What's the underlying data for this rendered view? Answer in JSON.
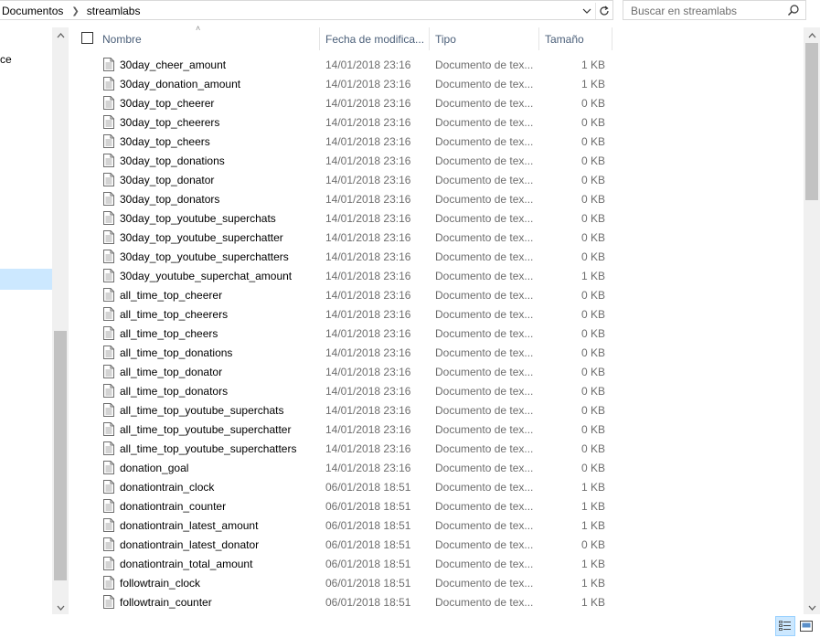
{
  "address": {
    "crumbs": [
      "Documentos",
      "streamlabs"
    ],
    "dropdown_icon": "chevron-down-icon",
    "refresh_icon": "refresh-icon"
  },
  "search": {
    "placeholder": "Buscar en streamlabs",
    "icon": "search-icon"
  },
  "nav": {
    "partial_label": "ce"
  },
  "columns": {
    "name": "Nombre",
    "date": "Fecha de modifica...",
    "type": "Tipo",
    "size": "Tamaño"
  },
  "files": [
    {
      "name": "30day_cheer_amount",
      "date": "14/01/2018 23:16",
      "type": "Documento de tex...",
      "size": "1 KB"
    },
    {
      "name": "30day_donation_amount",
      "date": "14/01/2018 23:16",
      "type": "Documento de tex...",
      "size": "1 KB"
    },
    {
      "name": "30day_top_cheerer",
      "date": "14/01/2018 23:16",
      "type": "Documento de tex...",
      "size": "0 KB"
    },
    {
      "name": "30day_top_cheerers",
      "date": "14/01/2018 23:16",
      "type": "Documento de tex...",
      "size": "0 KB"
    },
    {
      "name": "30day_top_cheers",
      "date": "14/01/2018 23:16",
      "type": "Documento de tex...",
      "size": "0 KB"
    },
    {
      "name": "30day_top_donations",
      "date": "14/01/2018 23:16",
      "type": "Documento de tex...",
      "size": "0 KB"
    },
    {
      "name": "30day_top_donator",
      "date": "14/01/2018 23:16",
      "type": "Documento de tex...",
      "size": "0 KB"
    },
    {
      "name": "30day_top_donators",
      "date": "14/01/2018 23:16",
      "type": "Documento de tex...",
      "size": "0 KB"
    },
    {
      "name": "30day_top_youtube_superchats",
      "date": "14/01/2018 23:16",
      "type": "Documento de tex...",
      "size": "0 KB"
    },
    {
      "name": "30day_top_youtube_superchatter",
      "date": "14/01/2018 23:16",
      "type": "Documento de tex...",
      "size": "0 KB"
    },
    {
      "name": "30day_top_youtube_superchatters",
      "date": "14/01/2018 23:16",
      "type": "Documento de tex...",
      "size": "0 KB"
    },
    {
      "name": "30day_youtube_superchat_amount",
      "date": "14/01/2018 23:16",
      "type": "Documento de tex...",
      "size": "1 KB"
    },
    {
      "name": "all_time_top_cheerer",
      "date": "14/01/2018 23:16",
      "type": "Documento de tex...",
      "size": "0 KB"
    },
    {
      "name": "all_time_top_cheerers",
      "date": "14/01/2018 23:16",
      "type": "Documento de tex...",
      "size": "0 KB"
    },
    {
      "name": "all_time_top_cheers",
      "date": "14/01/2018 23:16",
      "type": "Documento de tex...",
      "size": "0 KB"
    },
    {
      "name": "all_time_top_donations",
      "date": "14/01/2018 23:16",
      "type": "Documento de tex...",
      "size": "0 KB"
    },
    {
      "name": "all_time_top_donator",
      "date": "14/01/2018 23:16",
      "type": "Documento de tex...",
      "size": "0 KB"
    },
    {
      "name": "all_time_top_donators",
      "date": "14/01/2018 23:16",
      "type": "Documento de tex...",
      "size": "0 KB"
    },
    {
      "name": "all_time_top_youtube_superchats",
      "date": "14/01/2018 23:16",
      "type": "Documento de tex...",
      "size": "0 KB"
    },
    {
      "name": "all_time_top_youtube_superchatter",
      "date": "14/01/2018 23:16",
      "type": "Documento de tex...",
      "size": "0 KB"
    },
    {
      "name": "all_time_top_youtube_superchatters",
      "date": "14/01/2018 23:16",
      "type": "Documento de tex...",
      "size": "0 KB"
    },
    {
      "name": "donation_goal",
      "date": "14/01/2018 23:16",
      "type": "Documento de tex...",
      "size": "0 KB"
    },
    {
      "name": "donationtrain_clock",
      "date": "06/01/2018 18:51",
      "type": "Documento de tex...",
      "size": "1 KB"
    },
    {
      "name": "donationtrain_counter",
      "date": "06/01/2018 18:51",
      "type": "Documento de tex...",
      "size": "1 KB"
    },
    {
      "name": "donationtrain_latest_amount",
      "date": "06/01/2018 18:51",
      "type": "Documento de tex...",
      "size": "1 KB"
    },
    {
      "name": "donationtrain_latest_donator",
      "date": "06/01/2018 18:51",
      "type": "Documento de tex...",
      "size": "0 KB"
    },
    {
      "name": "donationtrain_total_amount",
      "date": "06/01/2018 18:51",
      "type": "Documento de tex...",
      "size": "1 KB"
    },
    {
      "name": "followtrain_clock",
      "date": "06/01/2018 18:51",
      "type": "Documento de tex...",
      "size": "1 KB"
    },
    {
      "name": "followtrain_counter",
      "date": "06/01/2018 18:51",
      "type": "Documento de tex...",
      "size": "1 KB"
    }
  ],
  "file_icon": "text-document-icon",
  "statusbar": {
    "details_view_icon": "details-view-icon",
    "large_icons_view_icon": "large-icons-view-icon"
  },
  "colors": {
    "selection": "#cce8ff",
    "header_text": "#4c607a",
    "meta_text": "#6d6d6d"
  }
}
